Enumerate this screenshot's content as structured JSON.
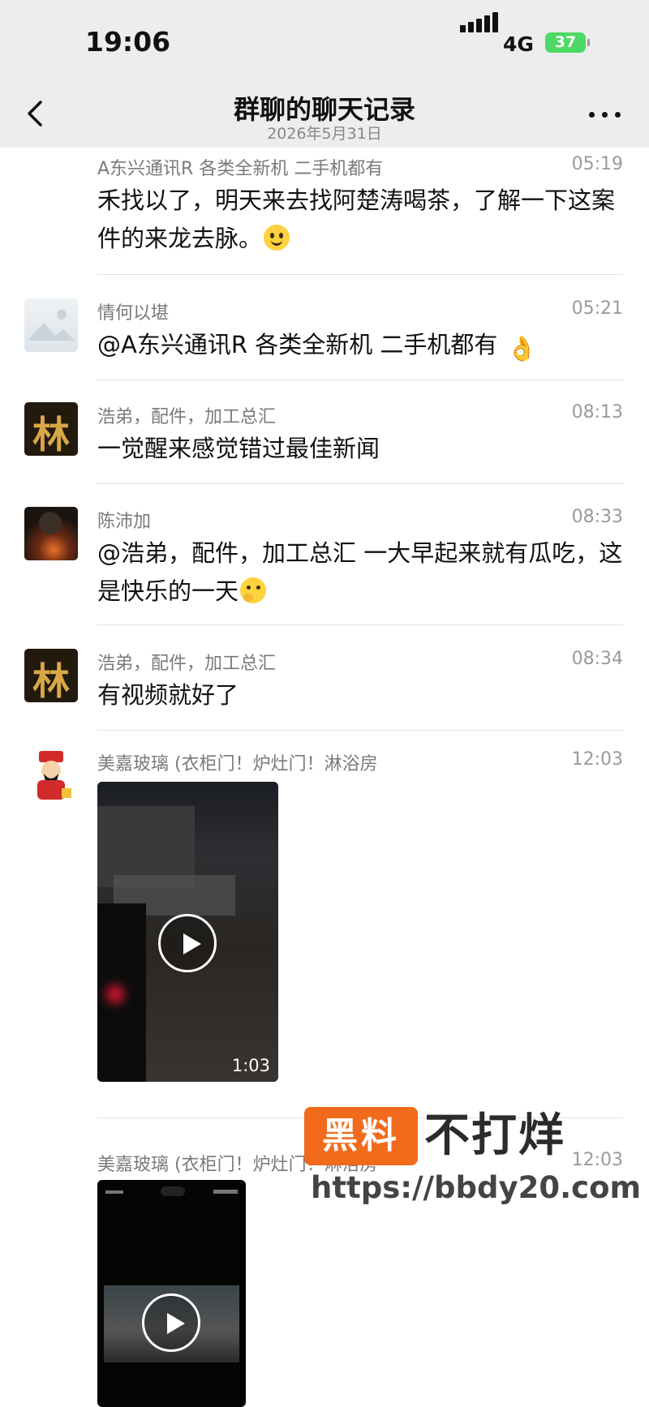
{
  "status_bar": {
    "time": "19:06",
    "network": "4G",
    "battery": "37"
  },
  "nav": {
    "title": "群聊的聊天记录",
    "date": "2026年5月31日"
  },
  "messages": [
    {
      "sender": "A东兴通讯R 各类全新机 二手机都有",
      "time": "05:19",
      "text": "禾找以了，明天来去找阿楚涛喝茶，了解一下这案件的来龙去脉。",
      "emoji": "smile"
    },
    {
      "sender": "情何以堪",
      "time": "05:21",
      "text": "@A东兴通讯R 各类全新机 二手机都有 ",
      "emoji": "ok-hand"
    },
    {
      "sender": "浩弟，配件，加工总汇",
      "time": "08:13",
      "text": "一觉醒来感觉错过最佳新闻"
    },
    {
      "sender": "陈沛加",
      "time": "08:33",
      "text": "@浩弟，配件，加工总汇 一大早起来就有瓜吃，这是快乐的一天",
      "emoji": "thinking"
    },
    {
      "sender": "浩弟，配件，加工总汇",
      "time": "08:34",
      "text": "有视频就好了"
    },
    {
      "sender": "美嘉玻璃 (衣柜门！炉灶门！淋浴房",
      "time": "12:03",
      "video_duration": "1:03"
    },
    {
      "sender": "美嘉玻璃 (衣柜门！炉灶门！淋浴房",
      "time": "12:03"
    }
  ],
  "avatars": {
    "hao_di_char": "林"
  },
  "watermark": {
    "box_text": "黑料",
    "text": "不打烊",
    "url": "https://bbdy20.com"
  },
  "colors": {
    "accent_orange": "#f26a1b",
    "battery_green": "#4cd964",
    "nav_bg": "#ededed"
  }
}
